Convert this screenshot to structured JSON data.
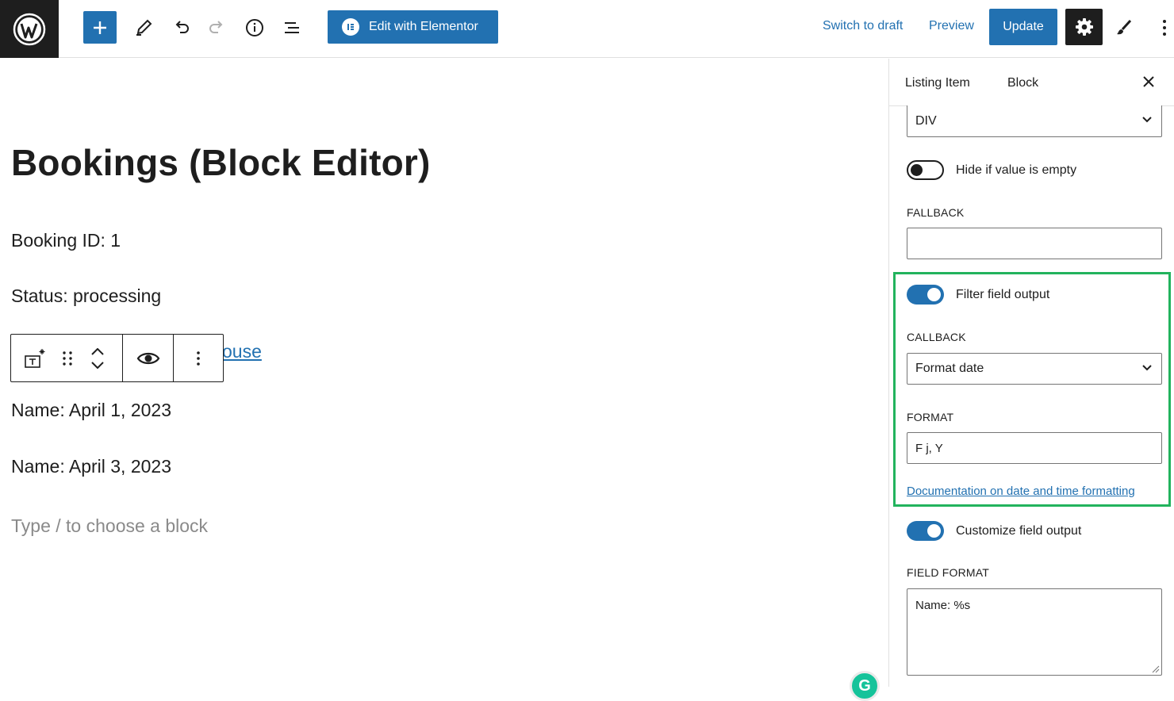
{
  "toolbar": {
    "edit_with_elementor": "Edit with Elementor",
    "switch_to_draft": "Switch to draft",
    "preview": "Preview",
    "update": "Update"
  },
  "editor": {
    "post_title": "Bookings (Block Editor)",
    "paragraphs": [
      "Booking ID: 1",
      "Status: processing",
      "Name: April 1, 2023",
      "Name: April 3, 2023"
    ],
    "partial_link_text": "ouse",
    "placeholder": "Type / to choose a block"
  },
  "sidebar": {
    "tabs": [
      "Listing Item",
      "Block"
    ],
    "active_tab": "Block",
    "tag_select": "DIV",
    "hide_if_empty": {
      "label": "Hide if value is empty",
      "enabled": false
    },
    "fallback": {
      "label": "FALLBACK",
      "value": ""
    },
    "filter_output": {
      "label": "Filter field output",
      "enabled": true
    },
    "callback": {
      "label": "CALLBACK",
      "value": "Format date"
    },
    "format": {
      "label": "FORMAT",
      "value": "F j, Y"
    },
    "doc_link": "Documentation on date and time formatting",
    "customize_output": {
      "label": "Customize field output",
      "enabled": true
    },
    "field_format": {
      "label": "FIELD FORMAT",
      "value": "Name: %s"
    }
  },
  "colors": {
    "accent": "#2271b1",
    "highlight": "#22b35d",
    "dark": "#1e1e1e"
  }
}
